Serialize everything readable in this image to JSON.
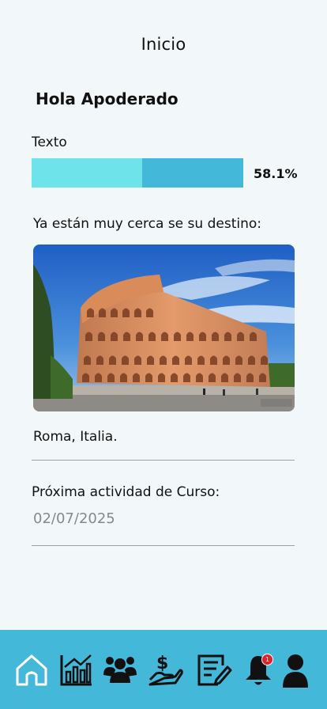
{
  "header": {
    "title": "Inicio"
  },
  "greeting": "Hola Apoderado",
  "progress": {
    "label": "Texto",
    "value_text": "58.1%",
    "fraction": 0.581
  },
  "destino": {
    "label": "Ya están muy cerca se su destino:",
    "place": "Roma, Italia."
  },
  "activity": {
    "label": "Próxima actividad de Curso:",
    "date": "02/07/2025"
  },
  "nav": {
    "items": [
      {
        "icon": "home-icon"
      },
      {
        "icon": "chart-icon"
      },
      {
        "icon": "group-icon"
      },
      {
        "icon": "payment-icon"
      },
      {
        "icon": "notes-icon"
      },
      {
        "icon": "bell-icon"
      },
      {
        "icon": "user-icon"
      }
    ],
    "notification_count": "1"
  },
  "colors": {
    "background": "#f2f8f9",
    "accent": "#44b8d9",
    "progress_fill": "#6ee4ea",
    "badge": "#e0202a"
  }
}
